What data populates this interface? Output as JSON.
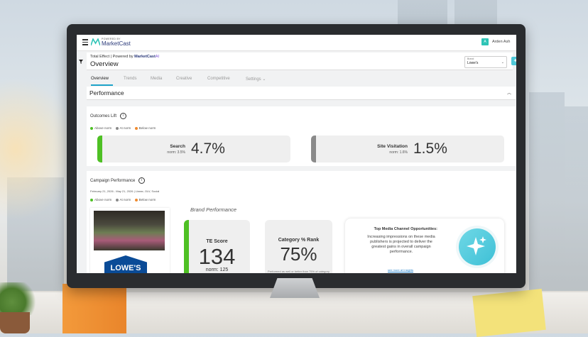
{
  "app": {
    "brand_prefix": "POWERED BY",
    "brand_name": "MarketCast",
    "user_initial": "A",
    "user_name": "Arden Ash"
  },
  "title_card": {
    "product_line": "Total Effect | Powered by",
    "product_brand": "MarketCast",
    "product_ai": "AI",
    "page_title": "Overview",
    "brand_select_label": "Brand",
    "brand_select_value": "Lowe's"
  },
  "tabs": [
    {
      "label": "Overview",
      "active": true
    },
    {
      "label": "Trends",
      "active": false
    },
    {
      "label": "Media",
      "active": false
    },
    {
      "label": "Creative",
      "active": false
    },
    {
      "label": "Competitive",
      "active": false
    },
    {
      "label": "Settings",
      "active": false
    }
  ],
  "performance": {
    "title": "Performance"
  },
  "outcomes": {
    "title": "Outcomes Lift",
    "legend": {
      "above": "Above norm",
      "at": "At norm",
      "below": "Below norm"
    },
    "cards": [
      {
        "label": "Search",
        "norm": "norm: 3.5%",
        "value": "4.7%",
        "status_color": "#4ec024"
      },
      {
        "label": "Site Visitation",
        "norm": "norm: 1.6%",
        "value": "1.5%",
        "status_color": "#8a8a8a"
      }
    ]
  },
  "campaign": {
    "title": "Campaign Performance",
    "date_range": "February 21, 2026 - May 21, 2026 | Linear, OLV, Social",
    "legend": {
      "above": "Above norm",
      "at": "At norm",
      "below": "Below norm"
    },
    "logo_text": "LOWE'S",
    "brand_performance_title": "Brand Performance",
    "te_score_label": "TE Score",
    "te_score_value": "134",
    "te_score_norm": "norm: 125",
    "category_label": "Category % Rank",
    "category_value": "75%",
    "category_sub": "Performed as well or better than 75% of category",
    "opportunities_title": "Top Media Channel Opportunities:",
    "opportunities_body": "Increasing impressions on these media publishers is projected to deliver the greatest gains in overall campaign performance.",
    "opportunities_link": "see more at Insights"
  },
  "colors": {
    "above_norm": "#4ec024",
    "at_norm": "#8a8a8a",
    "below_norm": "#f08a2e",
    "accent": "#1ea4c9"
  }
}
